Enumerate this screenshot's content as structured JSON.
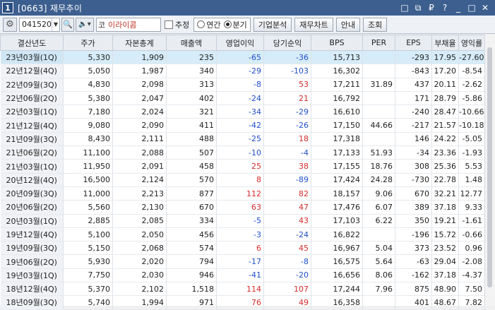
{
  "window": {
    "number": "1",
    "title": "[0663] 재무추이",
    "controls": [
      "□",
      "⧉",
      "₽",
      "?",
      "_",
      "□",
      "✕"
    ]
  },
  "toolbar": {
    "code_value": "041520",
    "market_mark": "코",
    "company_name": "이라이콤",
    "estimate_label": "추정",
    "radio_yearly": "연간",
    "radio_quarterly": "분기",
    "buttons": [
      "기업분석",
      "재무차트",
      "안내",
      "조회"
    ]
  },
  "table": {
    "columns": [
      "결산년도",
      "주가",
      "자본총계",
      "매출액",
      "영업이익",
      "당기순익",
      "BPS",
      "PER",
      "EPS",
      "부채율",
      "영익률"
    ],
    "rows": [
      [
        "23년03월(1Q)",
        "5,330",
        "1,909",
        "235",
        "-65",
        "-36",
        "15,713",
        "",
        "-293",
        "17.95",
        "-27.60"
      ],
      [
        "22년12월(4Q)",
        "5,050",
        "1,987",
        "340",
        "-29",
        "-103",
        "16,302",
        "",
        "-843",
        "17.20",
        "-8.54"
      ],
      [
        "22년09월(3Q)",
        "4,830",
        "2,098",
        "313",
        "-8",
        "53",
        "17,211",
        "31.89",
        "437",
        "20.11",
        "-2.62"
      ],
      [
        "22년06월(2Q)",
        "5,380",
        "2,047",
        "402",
        "-24",
        "21",
        "16,792",
        "",
        "171",
        "28.79",
        "-5.86"
      ],
      [
        "22년03월(1Q)",
        "7,180",
        "2,024",
        "321",
        "-34",
        "-29",
        "16,610",
        "",
        "-240",
        "28.47",
        "-10.66"
      ],
      [
        "21년12월(4Q)",
        "9,080",
        "2,090",
        "411",
        "-42",
        "-26",
        "17,150",
        "44.66",
        "-217",
        "21.57",
        "-10.18"
      ],
      [
        "21년09월(3Q)",
        "8,430",
        "2,111",
        "488",
        "-25",
        "18",
        "17,318",
        "",
        "146",
        "24.22",
        "-5.05"
      ],
      [
        "21년06월(2Q)",
        "11,100",
        "2,088",
        "507",
        "-10",
        "-4",
        "17,133",
        "51.93",
        "-34",
        "23.36",
        "-1.93"
      ],
      [
        "21년03월(1Q)",
        "11,950",
        "2,091",
        "458",
        "25",
        "38",
        "17,155",
        "18.76",
        "308",
        "25.36",
        "5.53"
      ],
      [
        "20년12월(4Q)",
        "16,500",
        "2,124",
        "570",
        "8",
        "-89",
        "17,424",
        "24.28",
        "-730",
        "22.78",
        "1.48"
      ],
      [
        "20년09월(3Q)",
        "11,000",
        "2,213",
        "877",
        "112",
        "82",
        "18,157",
        "9.06",
        "670",
        "32.21",
        "12.77"
      ],
      [
        "20년06월(2Q)",
        "5,560",
        "2,130",
        "670",
        "63",
        "47",
        "17,476",
        "6.07",
        "389",
        "37.18",
        "9.33"
      ],
      [
        "20년03월(1Q)",
        "2,885",
        "2,085",
        "334",
        "-5",
        "43",
        "17,103",
        "6.22",
        "350",
        "19.21",
        "-1.61"
      ],
      [
        "19년12월(4Q)",
        "5,100",
        "2,050",
        "456",
        "-3",
        "-24",
        "16,822",
        "",
        "-196",
        "15.72",
        "-0.66"
      ],
      [
        "19년09월(3Q)",
        "5,150",
        "2,068",
        "574",
        "6",
        "45",
        "16,967",
        "5.04",
        "373",
        "23.52",
        "0.96"
      ],
      [
        "19년06월(2Q)",
        "5,930",
        "2,020",
        "794",
        "-17",
        "-8",
        "16,575",
        "5.64",
        "-63",
        "29.04",
        "-2.08"
      ],
      [
        "19년03월(1Q)",
        "7,750",
        "2,030",
        "946",
        "-41",
        "-20",
        "16,656",
        "8.06",
        "-162",
        "37.18",
        "-4.37"
      ],
      [
        "18년12월(4Q)",
        "5,370",
        "2,102",
        "1,518",
        "114",
        "107",
        "17,244",
        "7.96",
        "875",
        "48.90",
        "7.50"
      ],
      [
        "18년09월(3Q)",
        "5,740",
        "1,994",
        "971",
        "76",
        "49",
        "16,358",
        "",
        "401",
        "48.67",
        "7.82"
      ]
    ]
  },
  "colors": {
    "title_bar": "#3d5f8f",
    "negative": "#1f4fc9",
    "positive": "#d42b2b",
    "selected_row": "#d6ecf8"
  }
}
